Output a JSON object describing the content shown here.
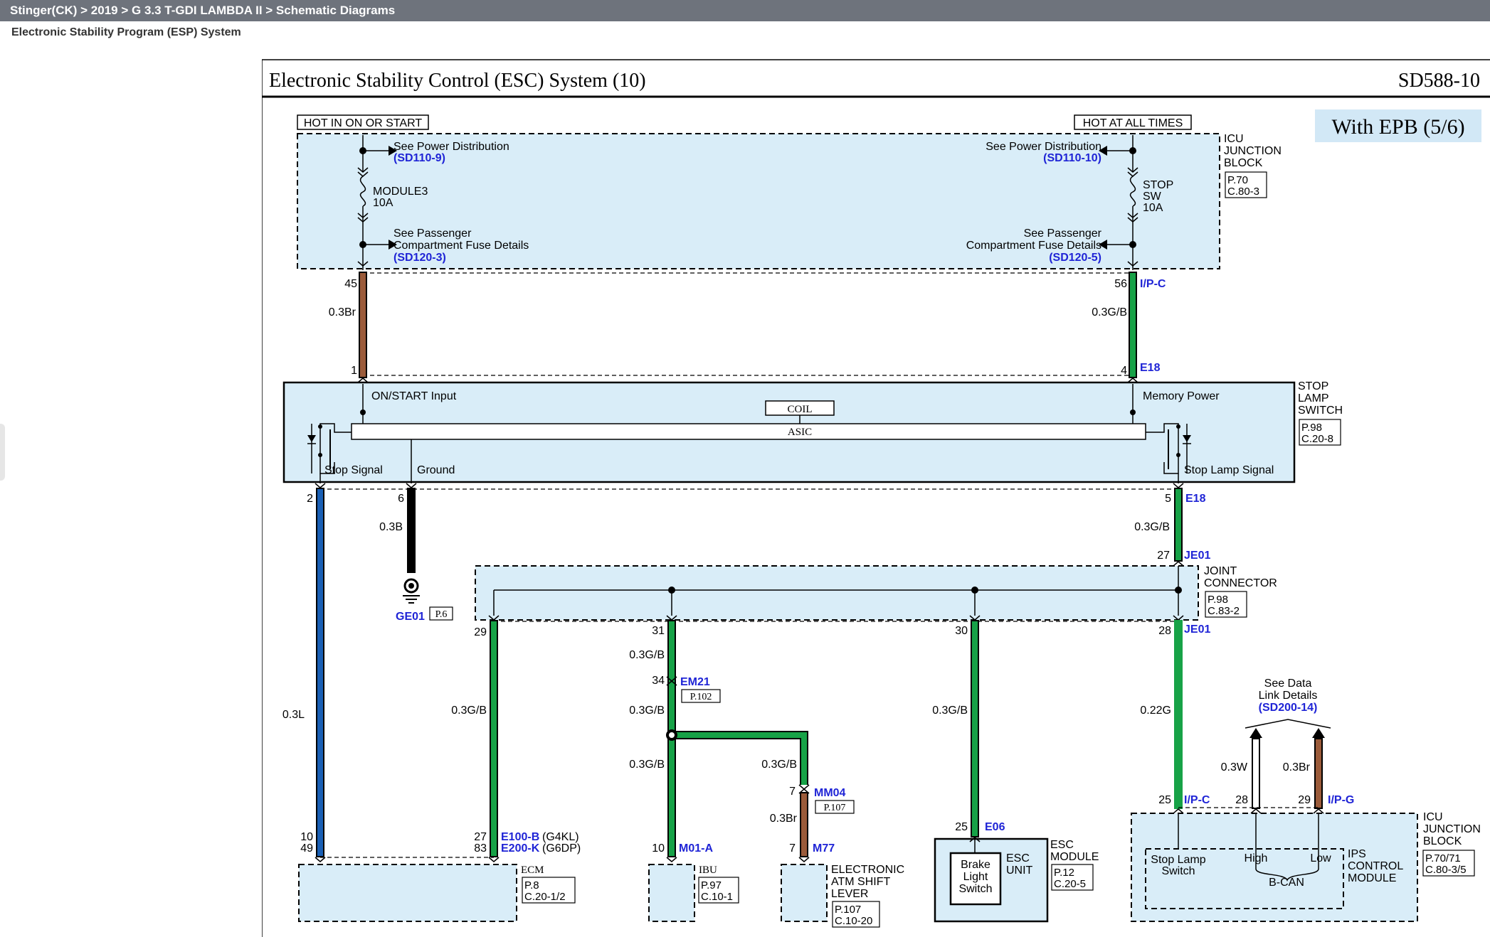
{
  "header": {
    "breadcrumb": "Stinger(CK) > 2019 > G 3.3 T-GDI LAMBDA II > Schematic Diagrams",
    "subtitle": "Electronic Stability Program (ESP) System"
  },
  "diagram": {
    "title": "Electronic Stability Control (ESC) System (10)",
    "code": "SD588-10",
    "variant": "With EPB (5/6)",
    "top_left": {
      "hot_label": "HOT IN ON OR START",
      "see1": "See Power Distribution",
      "see1_ref": "(SD110-9)",
      "fuse1": "MODULE3",
      "fuse2": "10A",
      "see2a": "See Passenger",
      "see2b": "Compartment Fuse Details",
      "see2_ref": "(SD120-3)"
    },
    "top_right": {
      "hot_label": "HOT AT ALL TIMES",
      "see1": "See Power Distribution",
      "see1_ref": "(SD110-10)",
      "fuse1": "STOP",
      "fuse2": "SW",
      "fuse3": "10A",
      "see2a": "See Passenger",
      "see2b": "Compartment Fuse Details",
      "see2_ref": "(SD120-5)"
    },
    "icu_block": {
      "l1": "ICU",
      "l2": "JUNCTION",
      "l3": "BLOCK",
      "p": "P.70",
      "c": "C.80-3"
    },
    "wires_top": {
      "pin45": "45",
      "w1": "0.3Br",
      "pin1": "1",
      "pin56": "56",
      "ipc": "I/P-C",
      "w2": "0.3G/B",
      "pin4": "4",
      "e18": "E18"
    },
    "stop_lamp_switch": {
      "on_start": "ON/START Input",
      "memory": "Memory Power",
      "coil": "COIL",
      "asic": "ASIC",
      "stop_signal": "Stop Signal",
      "ground": "Ground",
      "stop_lamp_signal": "Stop Lamp Signal",
      "l1": "STOP",
      "l2": "LAMP",
      "l3": "SWITCH",
      "p": "P.98",
      "c": "C.20-8"
    },
    "wires_mid": {
      "pin2": "2",
      "pin6": "6",
      "pin5": "5",
      "e18": "E18",
      "w_gnd": "0.3B",
      "w_gb": "0.3G/B",
      "pin27": "27",
      "je01": "JE01",
      "gnd_conn": "GE01",
      "gnd_ref": "P.6"
    },
    "joint": {
      "l1": "JOINT",
      "l2": "CONNECTOR",
      "p": "P.98",
      "c": "C.83-2",
      "pin29": "29",
      "pin31": "31",
      "pin30": "30",
      "pin28": "28",
      "je01": "JE01"
    },
    "wires_low": {
      "w_l": "0.3L",
      "w_gb1": "0.3G/B",
      "w_gb2": "0.3G/B",
      "w_gb3": "0.3G/B",
      "w_gb4": "0.3G/B",
      "w_gb5": "0.3G/B",
      "w_gb6": "0.3G/B",
      "w_22g": "0.22G",
      "pin34": "34",
      "em21": "EM21",
      "em21_ref": "P.102",
      "pin7a": "7",
      "mm04": "MM04",
      "mm04_ref": "P.107",
      "w_br": "0.3Br",
      "pin7b": "7",
      "m77": "M77",
      "pin10a": "10",
      "pin49": "49",
      "pin27b": "27",
      "pin83": "83",
      "e100": "E100-B",
      "g4kl": "(G4KL)",
      "e200": "E200-K",
      "g6dp": "(G6DP)",
      "pin10b": "10",
      "m01": "M01-A",
      "pin25a": "25",
      "e06": "E06"
    },
    "data_link": {
      "l1": "See Data",
      "l2": "Link Details",
      "ref": "(SD200-14)",
      "w_w": "0.3W",
      "w_br": "0.3Br",
      "pin25": "25",
      "ipc": "I/P-C",
      "pin28": "28",
      "pin29": "29",
      "ipg": "I/P-G"
    },
    "modules": {
      "ecm": "ECM",
      "ecm_p": "P.8",
      "ecm_c": "C.20-1/2",
      "ibu": "IBU",
      "ibu_p": "P.97",
      "ibu_c": "C.10-1",
      "atm1": "ELECTRONIC",
      "atm2": "ATM SHIFT",
      "atm3": "LEVER",
      "atm_p": "P.107",
      "atm_c": "C.10-20",
      "brake1": "Brake",
      "brake2": "Light",
      "brake3": "Switch",
      "esc1": "ESC",
      "esc2": "UNIT",
      "escm1": "ESC",
      "escm2": "MODULE",
      "escm_p": "P.12",
      "escm_c": "C.20-5",
      "sls1": "Stop Lamp",
      "sls2": "Switch",
      "high": "High",
      "low": "Low",
      "bcan": "B-CAN",
      "ips1": "IPS",
      "ips2": "CONTROL",
      "ips3": "MODULE",
      "icu1": "ICU",
      "icu2": "JUNCTION",
      "icu3": "BLOCK",
      "icu_p": "P.70/71",
      "icu_c": "C.80-3/5"
    }
  }
}
